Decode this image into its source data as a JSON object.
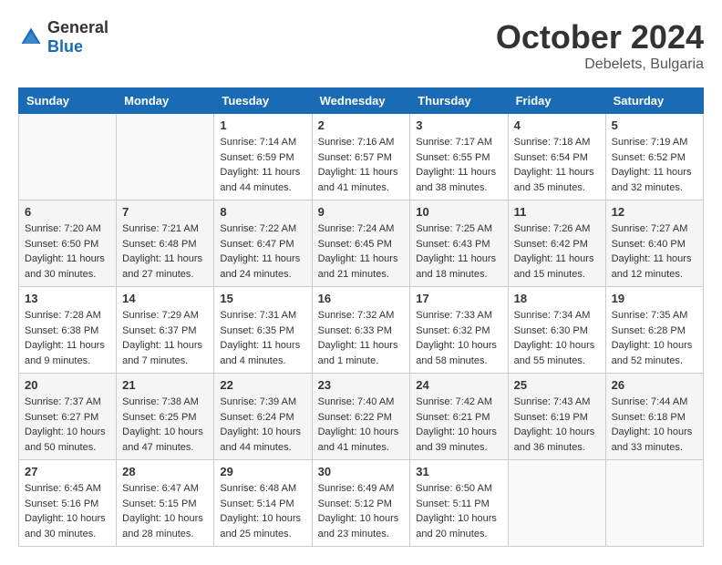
{
  "logo": {
    "general": "General",
    "blue": "Blue"
  },
  "header": {
    "month": "October 2024",
    "location": "Debelets, Bulgaria"
  },
  "weekdays": [
    "Sunday",
    "Monday",
    "Tuesday",
    "Wednesday",
    "Thursday",
    "Friday",
    "Saturday"
  ],
  "weeks": [
    [
      {
        "day": "",
        "sunrise": "",
        "sunset": "",
        "daylight": ""
      },
      {
        "day": "",
        "sunrise": "",
        "sunset": "",
        "daylight": ""
      },
      {
        "day": "1",
        "sunrise": "Sunrise: 7:14 AM",
        "sunset": "Sunset: 6:59 PM",
        "daylight": "Daylight: 11 hours and 44 minutes."
      },
      {
        "day": "2",
        "sunrise": "Sunrise: 7:16 AM",
        "sunset": "Sunset: 6:57 PM",
        "daylight": "Daylight: 11 hours and 41 minutes."
      },
      {
        "day": "3",
        "sunrise": "Sunrise: 7:17 AM",
        "sunset": "Sunset: 6:55 PM",
        "daylight": "Daylight: 11 hours and 38 minutes."
      },
      {
        "day": "4",
        "sunrise": "Sunrise: 7:18 AM",
        "sunset": "Sunset: 6:54 PM",
        "daylight": "Daylight: 11 hours and 35 minutes."
      },
      {
        "day": "5",
        "sunrise": "Sunrise: 7:19 AM",
        "sunset": "Sunset: 6:52 PM",
        "daylight": "Daylight: 11 hours and 32 minutes."
      }
    ],
    [
      {
        "day": "6",
        "sunrise": "Sunrise: 7:20 AM",
        "sunset": "Sunset: 6:50 PM",
        "daylight": "Daylight: 11 hours and 30 minutes."
      },
      {
        "day": "7",
        "sunrise": "Sunrise: 7:21 AM",
        "sunset": "Sunset: 6:48 PM",
        "daylight": "Daylight: 11 hours and 27 minutes."
      },
      {
        "day": "8",
        "sunrise": "Sunrise: 7:22 AM",
        "sunset": "Sunset: 6:47 PM",
        "daylight": "Daylight: 11 hours and 24 minutes."
      },
      {
        "day": "9",
        "sunrise": "Sunrise: 7:24 AM",
        "sunset": "Sunset: 6:45 PM",
        "daylight": "Daylight: 11 hours and 21 minutes."
      },
      {
        "day": "10",
        "sunrise": "Sunrise: 7:25 AM",
        "sunset": "Sunset: 6:43 PM",
        "daylight": "Daylight: 11 hours and 18 minutes."
      },
      {
        "day": "11",
        "sunrise": "Sunrise: 7:26 AM",
        "sunset": "Sunset: 6:42 PM",
        "daylight": "Daylight: 11 hours and 15 minutes."
      },
      {
        "day": "12",
        "sunrise": "Sunrise: 7:27 AM",
        "sunset": "Sunset: 6:40 PM",
        "daylight": "Daylight: 11 hours and 12 minutes."
      }
    ],
    [
      {
        "day": "13",
        "sunrise": "Sunrise: 7:28 AM",
        "sunset": "Sunset: 6:38 PM",
        "daylight": "Daylight: 11 hours and 9 minutes."
      },
      {
        "day": "14",
        "sunrise": "Sunrise: 7:29 AM",
        "sunset": "Sunset: 6:37 PM",
        "daylight": "Daylight: 11 hours and 7 minutes."
      },
      {
        "day": "15",
        "sunrise": "Sunrise: 7:31 AM",
        "sunset": "Sunset: 6:35 PM",
        "daylight": "Daylight: 11 hours and 4 minutes."
      },
      {
        "day": "16",
        "sunrise": "Sunrise: 7:32 AM",
        "sunset": "Sunset: 6:33 PM",
        "daylight": "Daylight: 11 hours and 1 minute."
      },
      {
        "day": "17",
        "sunrise": "Sunrise: 7:33 AM",
        "sunset": "Sunset: 6:32 PM",
        "daylight": "Daylight: 10 hours and 58 minutes."
      },
      {
        "day": "18",
        "sunrise": "Sunrise: 7:34 AM",
        "sunset": "Sunset: 6:30 PM",
        "daylight": "Daylight: 10 hours and 55 minutes."
      },
      {
        "day": "19",
        "sunrise": "Sunrise: 7:35 AM",
        "sunset": "Sunset: 6:28 PM",
        "daylight": "Daylight: 10 hours and 52 minutes."
      }
    ],
    [
      {
        "day": "20",
        "sunrise": "Sunrise: 7:37 AM",
        "sunset": "Sunset: 6:27 PM",
        "daylight": "Daylight: 10 hours and 50 minutes."
      },
      {
        "day": "21",
        "sunrise": "Sunrise: 7:38 AM",
        "sunset": "Sunset: 6:25 PM",
        "daylight": "Daylight: 10 hours and 47 minutes."
      },
      {
        "day": "22",
        "sunrise": "Sunrise: 7:39 AM",
        "sunset": "Sunset: 6:24 PM",
        "daylight": "Daylight: 10 hours and 44 minutes."
      },
      {
        "day": "23",
        "sunrise": "Sunrise: 7:40 AM",
        "sunset": "Sunset: 6:22 PM",
        "daylight": "Daylight: 10 hours and 41 minutes."
      },
      {
        "day": "24",
        "sunrise": "Sunrise: 7:42 AM",
        "sunset": "Sunset: 6:21 PM",
        "daylight": "Daylight: 10 hours and 39 minutes."
      },
      {
        "day": "25",
        "sunrise": "Sunrise: 7:43 AM",
        "sunset": "Sunset: 6:19 PM",
        "daylight": "Daylight: 10 hours and 36 minutes."
      },
      {
        "day": "26",
        "sunrise": "Sunrise: 7:44 AM",
        "sunset": "Sunset: 6:18 PM",
        "daylight": "Daylight: 10 hours and 33 minutes."
      }
    ],
    [
      {
        "day": "27",
        "sunrise": "Sunrise: 6:45 AM",
        "sunset": "Sunset: 5:16 PM",
        "daylight": "Daylight: 10 hours and 30 minutes."
      },
      {
        "day": "28",
        "sunrise": "Sunrise: 6:47 AM",
        "sunset": "Sunset: 5:15 PM",
        "daylight": "Daylight: 10 hours and 28 minutes."
      },
      {
        "day": "29",
        "sunrise": "Sunrise: 6:48 AM",
        "sunset": "Sunset: 5:14 PM",
        "daylight": "Daylight: 10 hours and 25 minutes."
      },
      {
        "day": "30",
        "sunrise": "Sunrise: 6:49 AM",
        "sunset": "Sunset: 5:12 PM",
        "daylight": "Daylight: 10 hours and 23 minutes."
      },
      {
        "day": "31",
        "sunrise": "Sunrise: 6:50 AM",
        "sunset": "Sunset: 5:11 PM",
        "daylight": "Daylight: 10 hours and 20 minutes."
      },
      {
        "day": "",
        "sunrise": "",
        "sunset": "",
        "daylight": ""
      },
      {
        "day": "",
        "sunrise": "",
        "sunset": "",
        "daylight": ""
      }
    ]
  ]
}
